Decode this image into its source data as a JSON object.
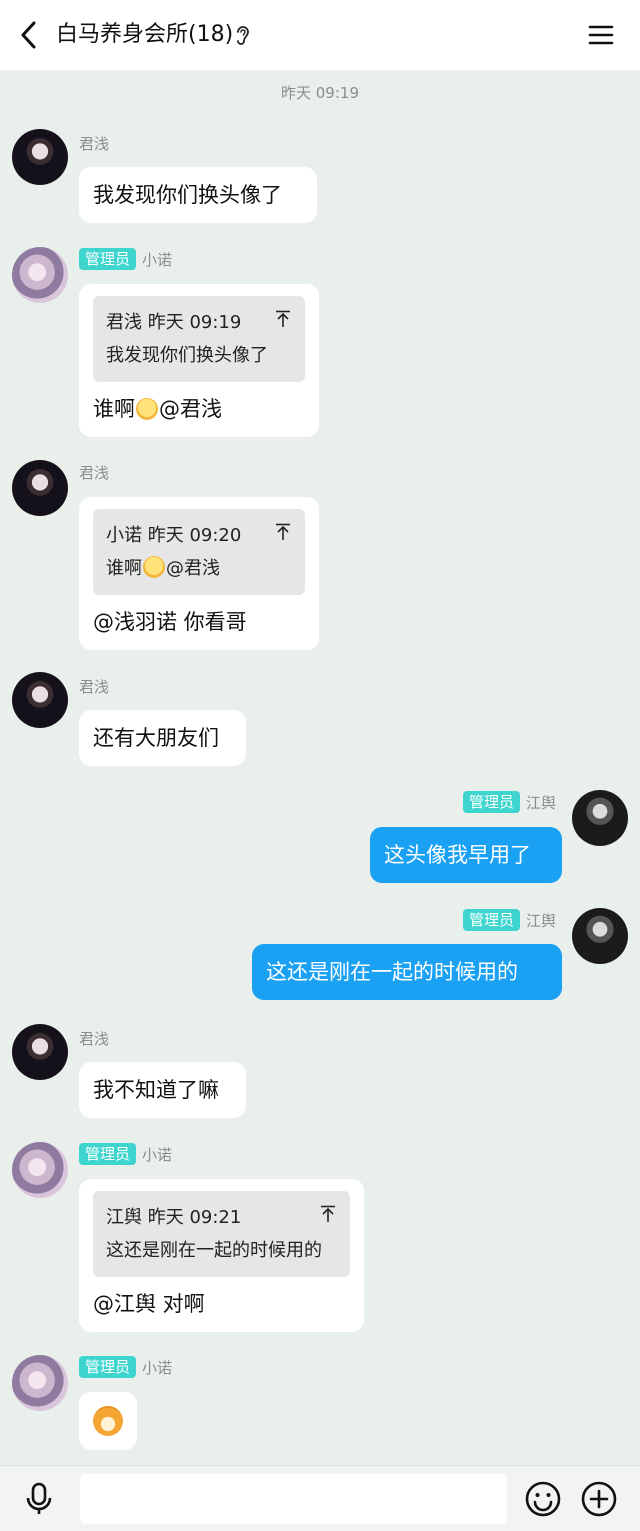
{
  "header": {
    "title": "白马养身会所(18)"
  },
  "timestamp": "昨天 09:19",
  "messages": [
    {
      "sender": "君浅",
      "text": "我发现你们换头像了"
    },
    {
      "badge": "管理员",
      "sender": "小诺",
      "quote_header": "君浅 昨天 09:19",
      "quote_text": "我发现你们换头像了",
      "text_pre": "谁啊",
      "text_post": "@君浅"
    },
    {
      "sender": "君浅",
      "quote_header": "小诺 昨天 09:20",
      "quote_text_pre": "谁啊",
      "quote_text_post": "@君浅",
      "text": "@浅羽诺 你看哥"
    },
    {
      "sender": "君浅",
      "text": "还有大朋友们"
    },
    {
      "badge": "管理员",
      "sender": "江舆",
      "text": "这头像我早用了"
    },
    {
      "badge": "管理员",
      "sender": "江舆",
      "text": "这还是刚在一起的时候用的"
    },
    {
      "sender": "君浅",
      "text": "我不知道了嘛"
    },
    {
      "badge": "管理员",
      "sender": "小诺",
      "quote_header": "江舆 昨天 09:21",
      "quote_text": "这还是刚在一起的时候用的",
      "text": "@江舆 对啊"
    },
    {
      "badge": "管理员",
      "sender": "小诺",
      "sticker": "dog-emoji"
    }
  ],
  "input": {
    "placeholder": ""
  }
}
